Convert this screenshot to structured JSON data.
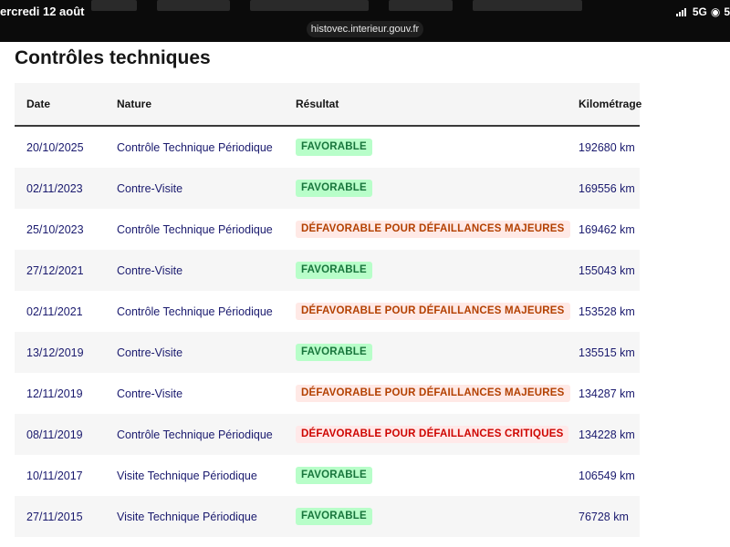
{
  "status_bar": {
    "datetime": "ercredi 12 août",
    "url": "histovec.interieur.gouv.fr",
    "network": "5G",
    "battery_partial": "5"
  },
  "page": {
    "title": "Contrôles techniques"
  },
  "table": {
    "headers": {
      "date": "Date",
      "nature": "Nature",
      "result": "Résultat",
      "mileage": "Kilométrage"
    },
    "rows": [
      {
        "date": "20/10/2025",
        "nature": "Contrôle Technique Périodique",
        "result": "FAVORABLE",
        "result_type": "favorable",
        "mileage": "192680 km"
      },
      {
        "date": "02/11/2023",
        "nature": "Contre-Visite",
        "result": "FAVORABLE",
        "result_type": "favorable",
        "mileage": "169556 km"
      },
      {
        "date": "25/10/2023",
        "nature": "Contrôle Technique Périodique",
        "result": "DÉFAVORABLE POUR DÉFAILLANCES MAJEURES",
        "result_type": "major",
        "mileage": "169462 km"
      },
      {
        "date": "27/12/2021",
        "nature": "Contre-Visite",
        "result": "FAVORABLE",
        "result_type": "favorable",
        "mileage": "155043 km"
      },
      {
        "date": "02/11/2021",
        "nature": "Contrôle Technique Périodique",
        "result": "DÉFAVORABLE POUR DÉFAILLANCES MAJEURES",
        "result_type": "major",
        "mileage": "153528 km"
      },
      {
        "date": "13/12/2019",
        "nature": "Contre-Visite",
        "result": "FAVORABLE",
        "result_type": "favorable",
        "mileage": "135515 km"
      },
      {
        "date": "12/11/2019",
        "nature": "Contre-Visite",
        "result": "DÉFAVORABLE POUR DÉFAILLANCES MAJEURES",
        "result_type": "major",
        "mileage": "134287 km"
      },
      {
        "date": "08/11/2019",
        "nature": "Contrôle Technique Périodique",
        "result": "DÉFAVORABLE POUR DÉFAILLANCES CRITIQUES",
        "result_type": "critical",
        "mileage": "134228 km"
      },
      {
        "date": "10/11/2017",
        "nature": "Visite Technique Périodique",
        "result": "FAVORABLE",
        "result_type": "favorable",
        "mileage": "106549 km"
      },
      {
        "date": "27/11/2015",
        "nature": "Visite Technique Périodique",
        "result": "FAVORABLE",
        "result_type": "favorable",
        "mileage": "76728 km"
      }
    ]
  },
  "colors": {
    "favorable_bg": "#b8fec9",
    "favorable_text": "#18753c",
    "major_bg": "#ffe9e6",
    "major_text": "#b34000",
    "critical_bg": "#ffe9e9",
    "critical_text": "#ce0500",
    "cell_text": "#1a1a6e"
  }
}
